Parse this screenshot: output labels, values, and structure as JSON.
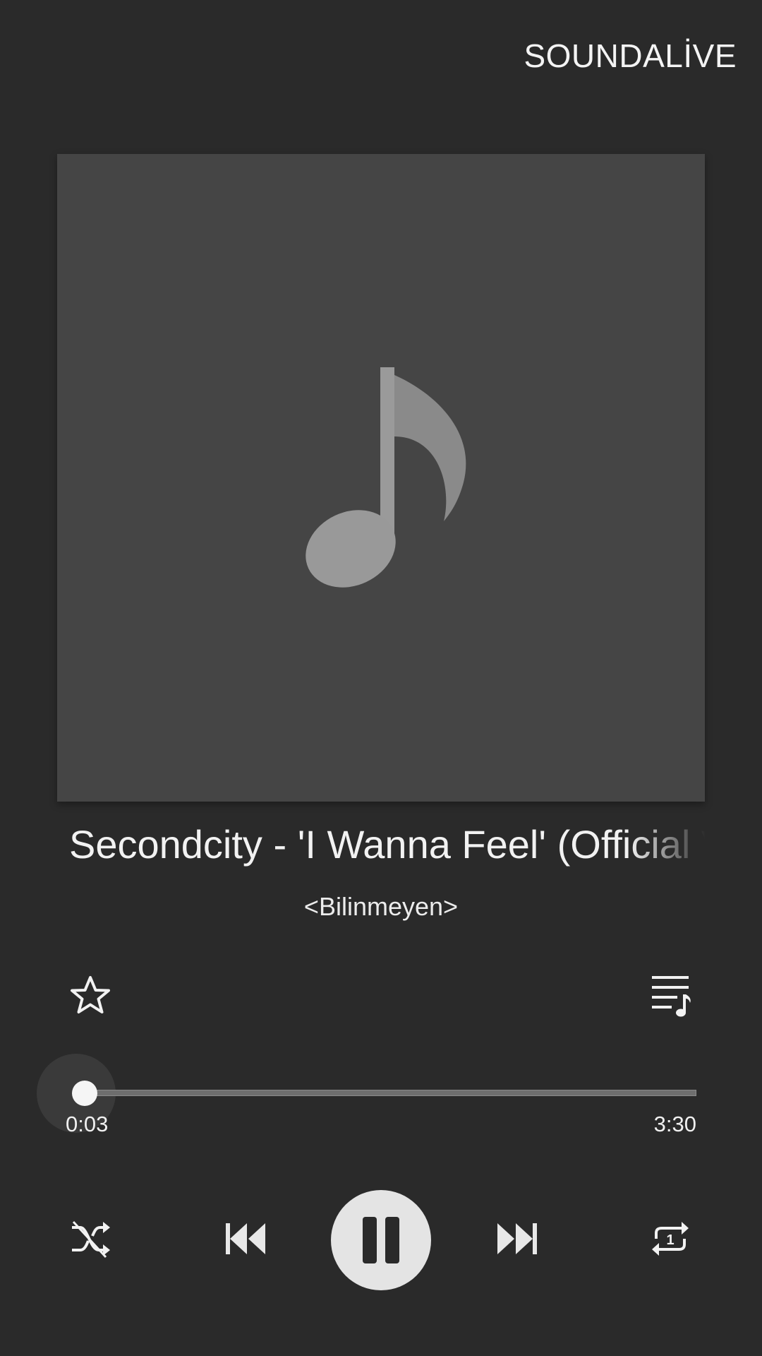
{
  "header": {
    "soundalive_label": "SOUNDALİVE"
  },
  "album_art": {
    "icon": "music-note-icon"
  },
  "track": {
    "title": "Secondcity - 'I Wanna Feel' (Official V",
    "artist": "<Bilinmeyen>"
  },
  "actions": {
    "favorite_icon": "star-outline-icon",
    "playlist_icon": "queue-music-icon"
  },
  "progress": {
    "current_time": "0:03",
    "total_time": "3:30",
    "fraction": 0.014
  },
  "controls": {
    "shuffle_icon": "shuffle-icon",
    "previous_icon": "skip-previous-icon",
    "play_pause_icon": "pause-icon",
    "next_icon": "skip-next-icon",
    "repeat_icon": "repeat-one-icon"
  },
  "colors": {
    "background": "#2a2a2a",
    "album_placeholder": "#454545",
    "note": "#999999",
    "accent_light": "#e4e4e4"
  }
}
